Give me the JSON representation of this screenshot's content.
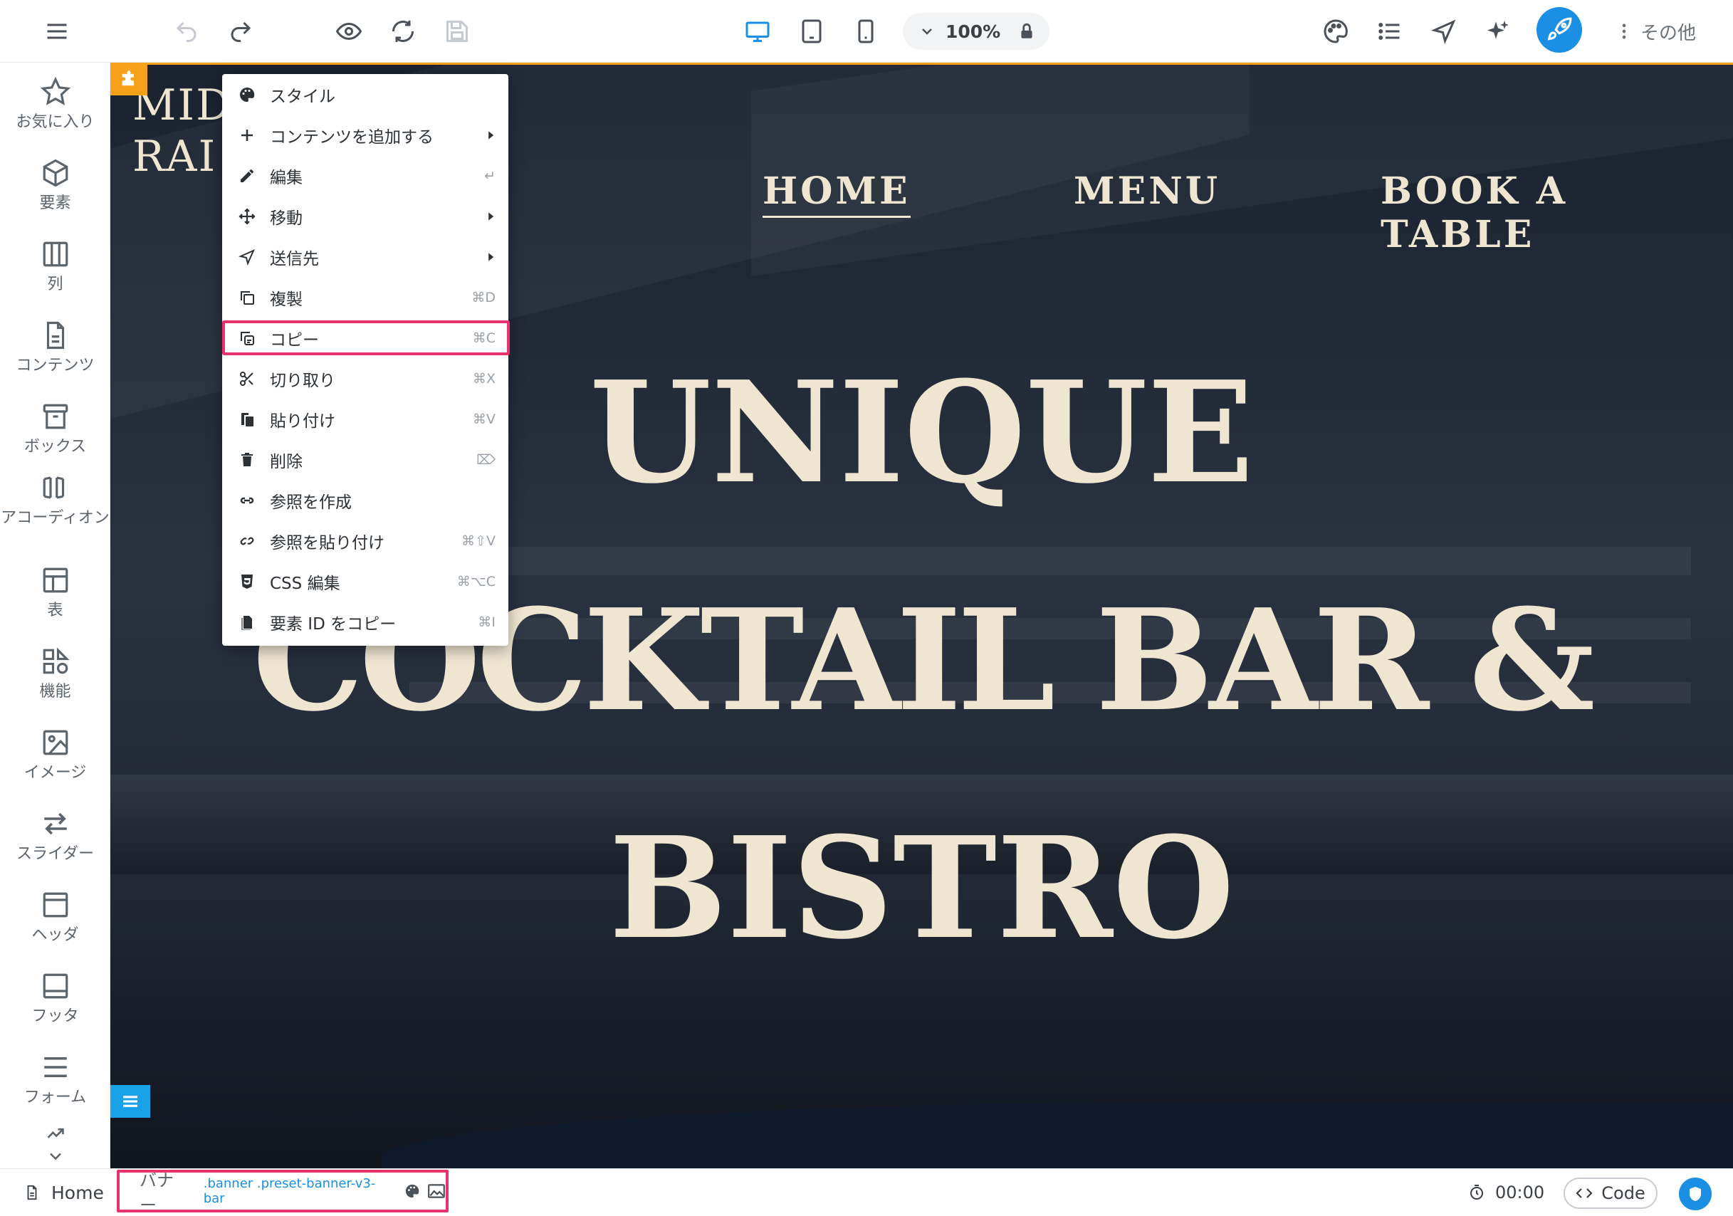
{
  "toolbar": {
    "zoom_value": "100%",
    "more_label": "その他",
    "accent_color": "#1a8fe3"
  },
  "sidebar": {
    "items": [
      {
        "label": "お気に入り",
        "icon": "star-icon"
      },
      {
        "label": "要素",
        "icon": "cube-icon"
      },
      {
        "label": "列",
        "icon": "columns-icon"
      },
      {
        "label": "コンテンツ",
        "icon": "document-icon"
      },
      {
        "label": "ボックス",
        "icon": "box-icon"
      },
      {
        "label": "アコーディオン",
        "icon": "accordion-icon"
      },
      {
        "label": "表",
        "icon": "table-icon"
      },
      {
        "label": "機能",
        "icon": "features-icon"
      },
      {
        "label": "イメージ",
        "icon": "image-icon"
      },
      {
        "label": "スライダー",
        "icon": "slider-icon"
      },
      {
        "label": "ヘッダ",
        "icon": "header-icon"
      },
      {
        "label": "フッタ",
        "icon": "footer-icon"
      },
      {
        "label": "フォーム",
        "icon": "form-icon"
      }
    ]
  },
  "site": {
    "logo_line1": "MID",
    "logo_line2": "RAI",
    "nav": [
      "HOME",
      "MENU",
      "BOOK A TABLE"
    ],
    "hero_line1": "UNIQUE",
    "hero_line2": "COCKTAIL BAR &",
    "hero_line3": "BISTRO",
    "text_color": "#efe6d2"
  },
  "context_menu": {
    "items": [
      {
        "label": "スタイル",
        "icon": "palette-icon",
        "shortcut": ""
      },
      {
        "label": "コンテンツを追加する",
        "icon": "plus-icon",
        "shortcut": ""
      },
      {
        "label": "編集",
        "icon": "pencil-icon",
        "shortcut": "↵"
      },
      {
        "label": "移動",
        "icon": "move-icon",
        "shortcut": ""
      },
      {
        "label": "送信先",
        "icon": "send-icon",
        "shortcut": ""
      },
      {
        "label": "複製",
        "icon": "duplicate-icon",
        "shortcut": "⌘D"
      },
      {
        "label": "コピー",
        "icon": "copy-icon",
        "shortcut": "⌘C"
      },
      {
        "label": "切り取り",
        "icon": "scissors-icon",
        "shortcut": "⌘X"
      },
      {
        "label": "貼り付け",
        "icon": "paste-icon",
        "shortcut": "⌘V"
      },
      {
        "label": "削除",
        "icon": "trash-icon",
        "shortcut": "⌦"
      },
      {
        "label": "参照を作成",
        "icon": "link-icon",
        "shortcut": ""
      },
      {
        "label": "参照を貼り付け",
        "icon": "link-paste-icon",
        "shortcut": "⌘⇧V"
      },
      {
        "label": "CSS 編集",
        "icon": "css-icon",
        "shortcut": "⌘⌥C"
      },
      {
        "label": "要素 ID をコピー",
        "icon": "id-copy-icon",
        "shortcut": "⌘I"
      }
    ],
    "highlighted": "コピー",
    "highlight_color": "#e8336d"
  },
  "bottombar": {
    "home_label": "Home",
    "breadcrumb_label": "バナー",
    "breadcrumb_selector": ".banner .preset-banner-v3-bar",
    "timer": "00:00",
    "code_label": "Code"
  }
}
